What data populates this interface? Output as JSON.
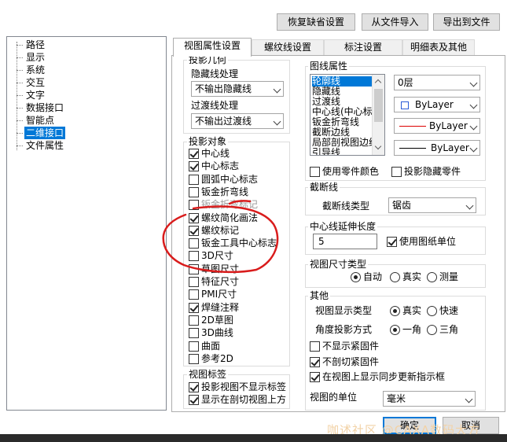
{
  "toolbar": {
    "restore_defaults": "恢复缺省设置",
    "import_file": "从文件导入",
    "export_file": "导出到文件"
  },
  "tree": {
    "items": [
      "路径",
      "显示",
      "系统",
      "交互",
      "文字",
      "数据接口",
      "智能点",
      "二维接口",
      "文件属性"
    ],
    "selected": "二维接口"
  },
  "tabs": [
    "视图属性设置",
    "螺纹线设置",
    "标注设置",
    "明细表及其他"
  ],
  "projection_geometry": {
    "title": "投影几何",
    "hidden_label": "隐藏线处理",
    "hidden_value": "不输出隐藏线",
    "transition_label": "过渡线处理",
    "transition_value": "不输出过渡线"
  },
  "projection_objects": {
    "title": "投影对象",
    "items": [
      {
        "label": "中心线",
        "checked": true
      },
      {
        "label": "中心标志",
        "checked": true
      },
      {
        "label": "圆弧中心标志",
        "checked": false
      },
      {
        "label": "钣金折弯线",
        "checked": false
      },
      {
        "label": "钣金折弯标记",
        "checked": false
      },
      {
        "label": "螺纹简化画法",
        "checked": true
      },
      {
        "label": "螺纹标记",
        "checked": true
      },
      {
        "label": "钣金工具中心标志",
        "checked": false
      },
      {
        "label": "3D尺寸",
        "checked": false
      },
      {
        "label": "草图尺寸",
        "checked": false
      },
      {
        "label": "特征尺寸",
        "checked": false
      },
      {
        "label": "PMI尺寸",
        "checked": false
      },
      {
        "label": "焊缝注释",
        "checked": true
      },
      {
        "label": "2D草图",
        "checked": false
      },
      {
        "label": "3D曲线",
        "checked": false
      },
      {
        "label": "曲面",
        "checked": false
      },
      {
        "label": "参考2D",
        "checked": false
      }
    ]
  },
  "view_label": {
    "title": "视图标签",
    "items": [
      {
        "label": "投影视图不显示标签",
        "checked": true
      },
      {
        "label": "显示在剖切视图上方",
        "checked": true
      }
    ]
  },
  "line_props": {
    "title": "图线属性",
    "list": [
      "轮廓线",
      "隐藏线",
      "过渡线",
      "中心线(中心标",
      "钣金折弯线",
      "截断边线",
      "局部剖视图边线",
      "引导线"
    ],
    "selected": "轮廓线",
    "layer": "0层",
    "color": "ByLayer",
    "linetype": "ByLayer",
    "lineweight": "ByLayer",
    "use_part_color": "使用零件颜色",
    "project_hidden_parts": "投影隐藏零件"
  },
  "break_line": {
    "title": "截断线",
    "type_label": "截断线类型",
    "type_value": "锯齿"
  },
  "centerline_ext": {
    "title": "中心线延伸长度",
    "value": "5",
    "use_drawing_unit": "使用图纸单位"
  },
  "dim_type": {
    "title": "视图尺寸类型",
    "options": [
      "自动",
      "真实",
      "测量"
    ],
    "selected": "自动"
  },
  "other": {
    "title": "其他",
    "display_type_label": "视图显示类型",
    "display_options": [
      "真实",
      "快速"
    ],
    "display_selected": "真实",
    "angle_label": "角度投影方式",
    "angle_options": [
      "一角",
      "三角"
    ],
    "angle_selected": "一角",
    "checks": [
      {
        "label": "不显示紧固件",
        "checked": false
      },
      {
        "label": "不剖切紧固件",
        "checked": true
      },
      {
        "label": "在视图上显示同步更新指示框",
        "checked": true
      }
    ],
    "unit_label": "视图的单位",
    "unit_value": "毫米"
  },
  "footer": {
    "ok": "确定",
    "cancel": "取消"
  },
  "watermark": "咖述社区 @CAXA数码大方"
}
